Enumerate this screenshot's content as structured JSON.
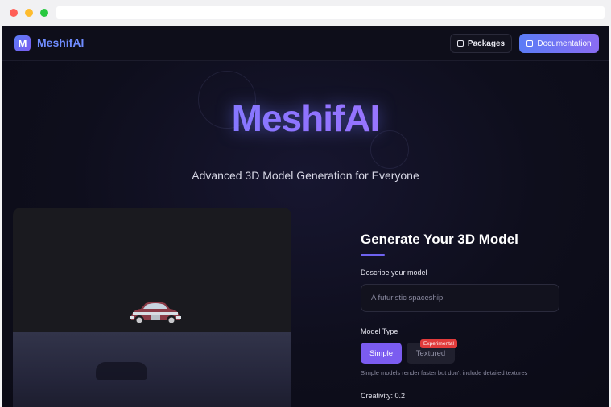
{
  "nav": {
    "logo_letter": "M",
    "brand": "MeshifAI",
    "packages_label": "Packages",
    "docs_label": "Documentation",
    "packages_icon": "cube-icon",
    "docs_icon": "document-icon"
  },
  "hero": {
    "title": "MeshifAI",
    "subtitle": "Advanced 3D Model Generation for Everyone"
  },
  "form": {
    "title": "Generate Your 3D Model",
    "describe_label": "Describe your model",
    "prompt_placeholder": "A futuristic spaceship",
    "model_type_label": "Model Type",
    "simple_label": "Simple",
    "textured_label": "Textured",
    "experimental_badge": "Experimental",
    "selected_type": "Simple",
    "hint": "Simple models render faster but don't include detailed textures",
    "creativity_label": "Creativity: 0.2"
  },
  "colors": {
    "accent": "#7b5cf0",
    "brand_blue": "#6f8cff",
    "badge_red": "#e23b3b",
    "background": "#0e0e1c"
  }
}
